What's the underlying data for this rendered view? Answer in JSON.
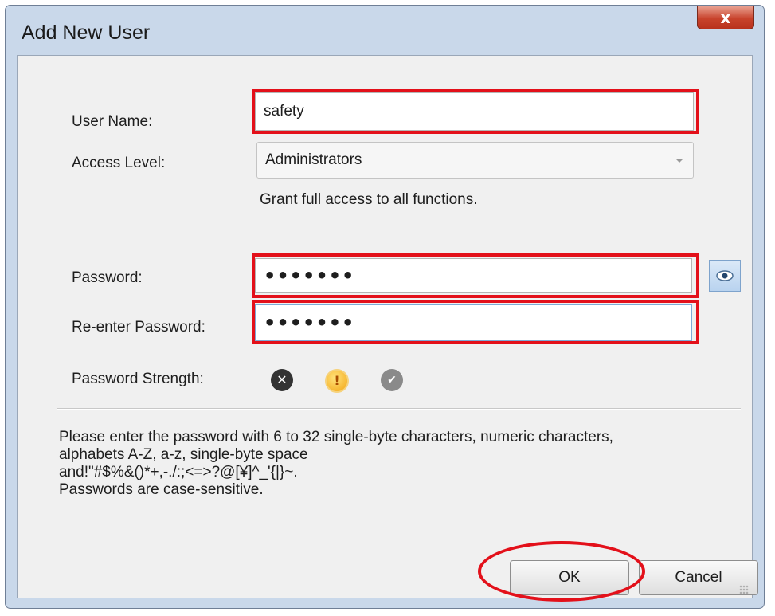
{
  "dialog": {
    "title": "Add New User",
    "close_label": "x"
  },
  "form": {
    "username_label": "User Name:",
    "username_value": "safety",
    "access_level_label": "Access Level:",
    "access_level_value": "Administrators",
    "access_level_description": "Grant full access to all functions.",
    "password_label": "Password:",
    "password_value": "•••••••",
    "reenter_label": "Re-enter Password:",
    "reenter_value": "•••••••",
    "strength_label": "Password Strength:",
    "strength_icons": [
      "x-circle-icon",
      "warning-circle-icon",
      "check-circle-icon"
    ]
  },
  "hint": {
    "lines": [
      "Please enter the password with 6 to 32 single-byte characters, numeric characters,",
      "alphabets A-Z, a-z, single-byte space",
      "and!\"#$%&()*+,-./:;<=>?@[¥]^_'{|}~.",
      "Passwords are case-sensitive."
    ]
  },
  "buttons": {
    "ok_label": "OK",
    "cancel_label": "Cancel"
  },
  "colors": {
    "highlight": "#e3101a",
    "title_bar": "#c9d8ea",
    "close_button": "#c8432c"
  }
}
